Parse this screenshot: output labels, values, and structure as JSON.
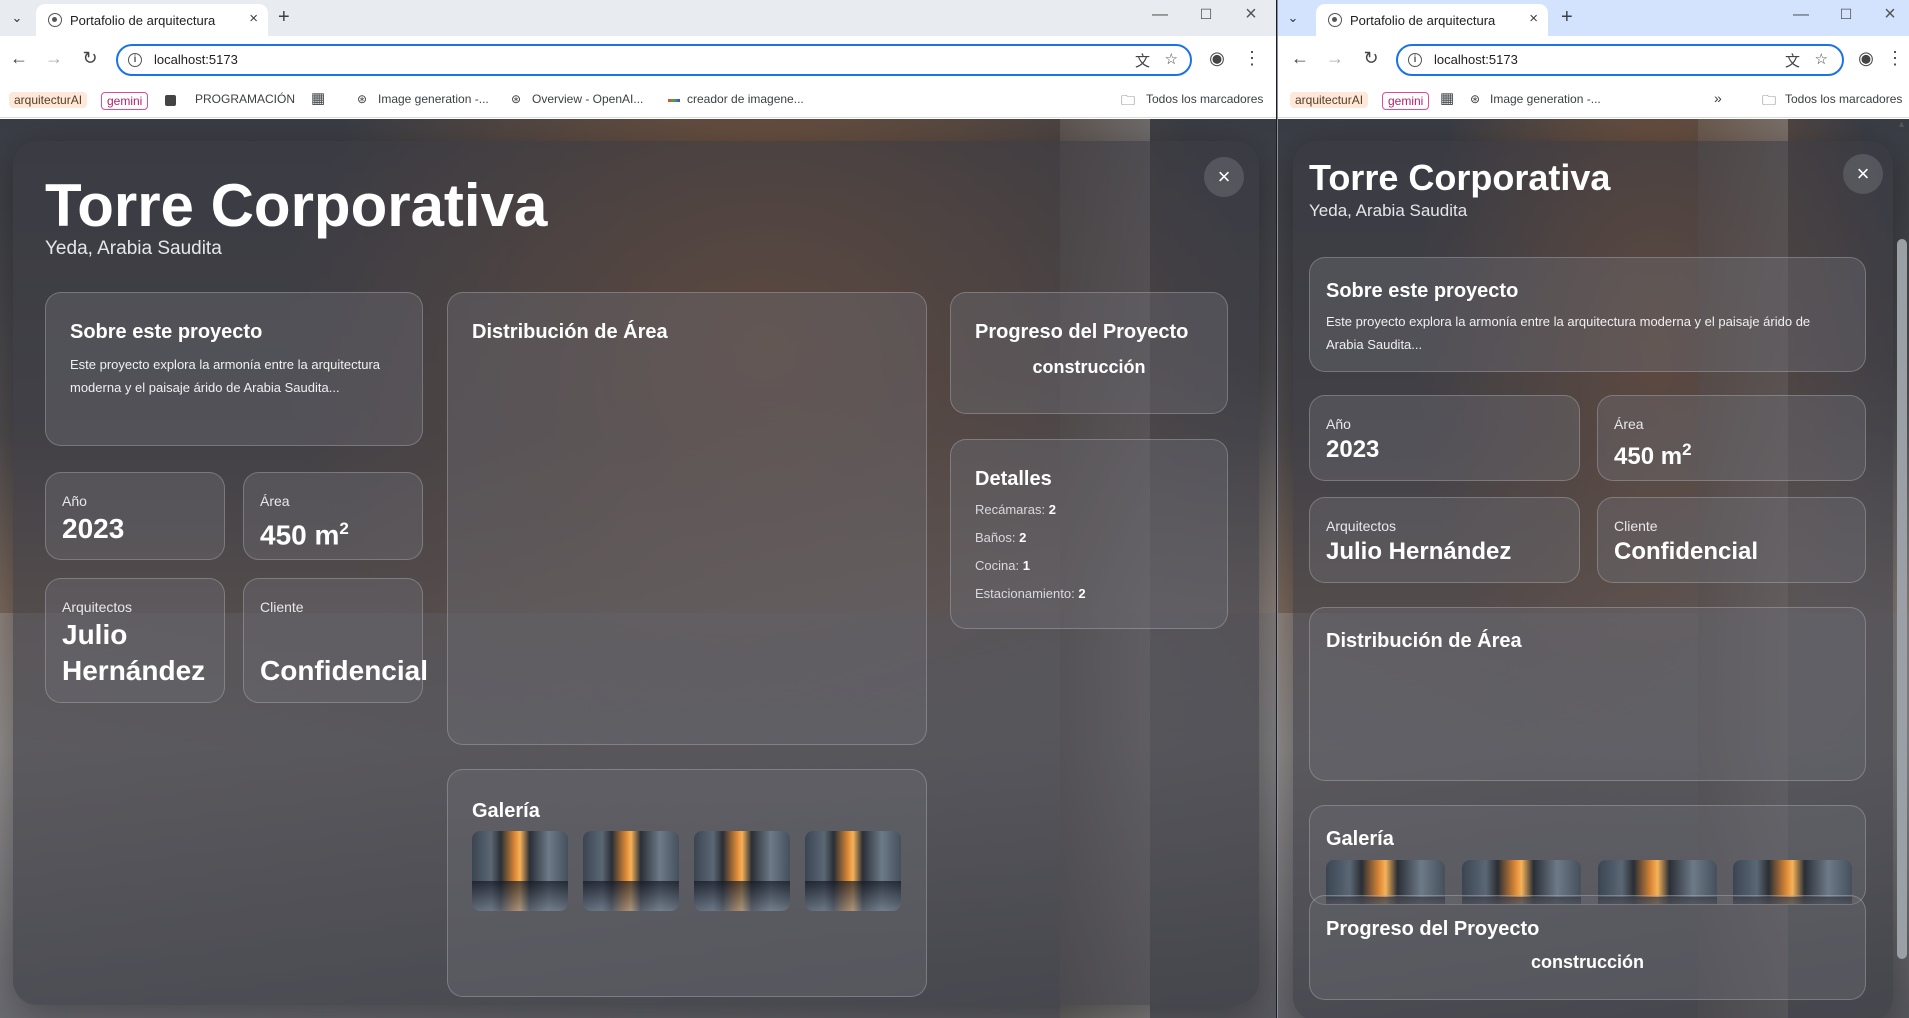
{
  "browser": {
    "tab_title": "Portafolio de arquitectura",
    "url": "localhost:5173",
    "bookmarks_left": [
      "arquitecturAI",
      "gemini",
      "PROGRAMACIÓN",
      "Image generation -...",
      "Overview - OpenAI...",
      "creador de imagene..."
    ],
    "bookmarks_right": [
      "arquitecturAI",
      "gemini",
      "Image generation -..."
    ],
    "all_bookmarks": "Todos los marcadores"
  },
  "project": {
    "title": "Torre Corporativa",
    "location": "Yeda, Arabia Saudita",
    "about_title": "Sobre este proyecto",
    "about_text": "Este proyecto explora la armonía entre la arquitectura moderna y el paisaje árido de Arabia Saudita...",
    "year_label": "Año",
    "year": "2023",
    "area_label": "Área",
    "area_value": "450 m",
    "area_unit_sup": "2",
    "architects_label": "Arquitectos",
    "architect_first": "Julio",
    "architect_last": "Hernández",
    "architect_full": "Julio Hernández",
    "client_label": "Cliente",
    "client": "Confidencial",
    "distribution_title": "Distribución de Área",
    "progress_title": "Progreso del Proyecto",
    "progress_status": "construcción",
    "details_title": "Detalles",
    "details": [
      {
        "label": "Recámaras:",
        "value": "2"
      },
      {
        "label": "Baños:",
        "value": "2"
      },
      {
        "label": "Cocina:",
        "value": "1"
      },
      {
        "label": "Estacionamiento:",
        "value": "2"
      }
    ],
    "gallery_title": "Galería"
  },
  "icons": {
    "close": "×",
    "back": "←",
    "forward": "→",
    "reload": "↻",
    "star": "☆",
    "menu": "⋮",
    "new_tab": "+",
    "minimize": "—",
    "maximize": "☐",
    "translate": "文",
    "profile": "◉",
    "apps": "▦",
    "folder": "🗀",
    "more": "»"
  }
}
